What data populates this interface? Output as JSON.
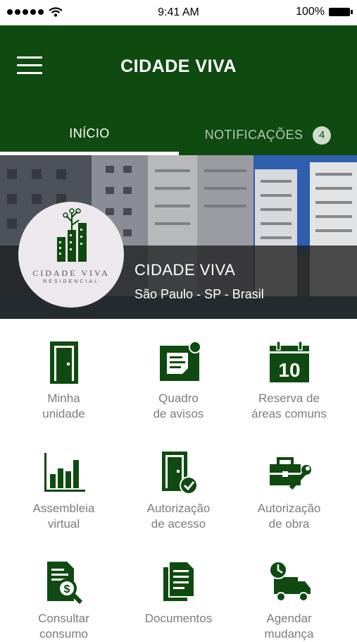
{
  "status_bar": {
    "time": "9:41 AM",
    "battery": "100%"
  },
  "header": {
    "title": "CIDADE VIVA"
  },
  "tabs": [
    {
      "label": "INÍCIO",
      "active": true
    },
    {
      "label": "NOTIFICAÇÕES",
      "badge": "4"
    }
  ],
  "condo": {
    "name": "CIDADE VIVA",
    "location": "São Paulo - SP - Brasil",
    "logo_line1": "CIDADE VIVA",
    "logo_line2": "RESIDENCIAL"
  },
  "menu": [
    {
      "label1": "Minha",
      "label2": "unidade",
      "icon": "door-icon"
    },
    {
      "label1": "Quadro",
      "label2": "de avisos",
      "icon": "notice-board-icon"
    },
    {
      "label1": "Reserva de",
      "label2": "áreas comuns",
      "icon": "calendar-icon",
      "icon_text": "10"
    },
    {
      "label1": "Assembleia",
      "label2": "virtual",
      "icon": "bar-chart-icon"
    },
    {
      "label1": "Autorização",
      "label2": "de acesso",
      "icon": "door-check-icon"
    },
    {
      "label1": "Autorização",
      "label2": "de obra",
      "icon": "toolbox-icon"
    },
    {
      "label1": "Consultar",
      "label2": "consumo",
      "icon": "invoice-search-icon"
    },
    {
      "label1": "Documentos",
      "label2": "",
      "icon": "documents-icon"
    },
    {
      "label1": "Agendar",
      "label2": "mudança",
      "icon": "moving-truck-icon"
    }
  ],
  "colors": {
    "brand_green": "#0f4a10",
    "label_gray": "#7c7c7c"
  }
}
